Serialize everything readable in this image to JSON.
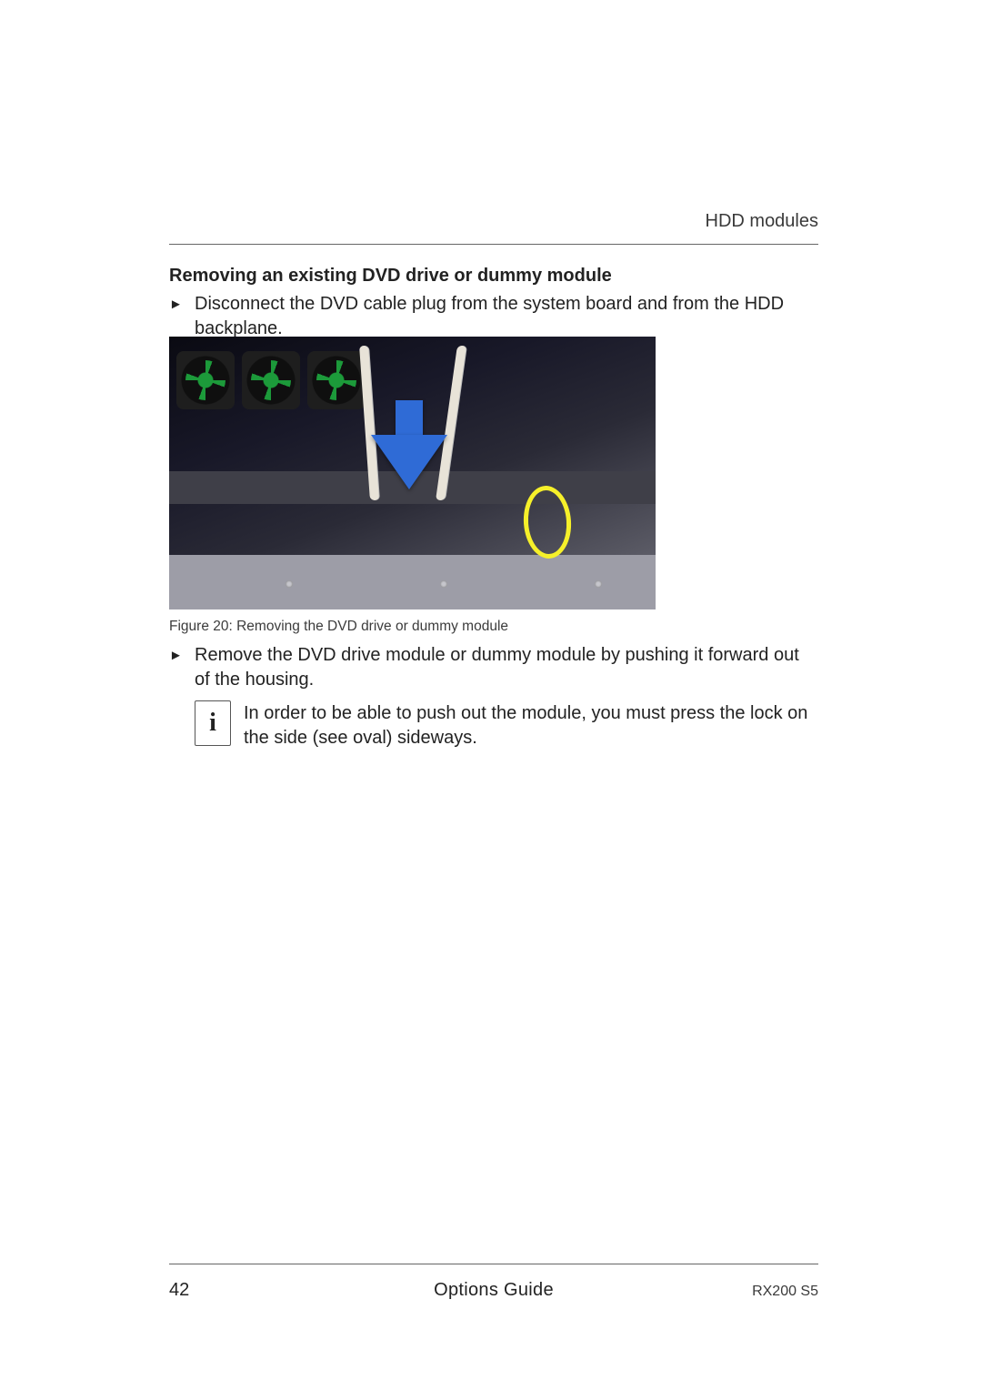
{
  "header": {
    "section": "HDD modules"
  },
  "section_title": "Removing an existing DVD drive or dummy module",
  "steps": {
    "s1": "Disconnect the DVD cable plug from the system board and from the HDD backplane.",
    "s2": "Remove the DVD drive module or dummy module by pushing it forward out of the housing."
  },
  "figure": {
    "caption": "Figure 20: Removing the DVD drive or dummy module"
  },
  "info": {
    "glyph": "i",
    "text": "In order to be able to push out the module, you must press the lock on the side (see oval) sideways."
  },
  "footer": {
    "page_number": "42",
    "center": "Options Guide",
    "model": "RX200 S5"
  },
  "glyphs": {
    "step_bullet": "►"
  }
}
